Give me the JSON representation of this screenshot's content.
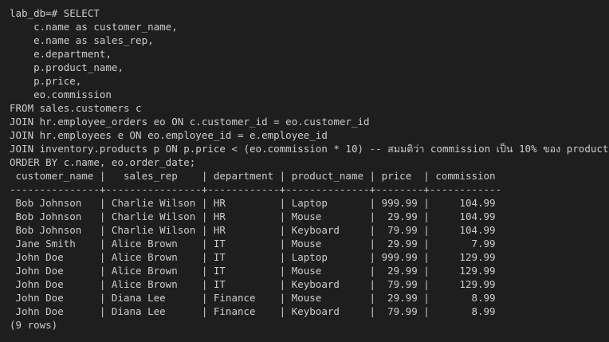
{
  "terminal": {
    "background": "#1e1e1e",
    "foreground": "#cccccc",
    "lines": [
      "lab_db=# SELECT",
      "    c.name as customer_name,",
      "    e.name as sales_rep,",
      "    e.department,",
      "    p.product_name,",
      "    p.price,",
      "    eo.commission",
      "FROM sales.customers c",
      "JOIN hr.employee_orders eo ON c.customer_id = eo.customer_id",
      "JOIN hr.employees e ON eo.employee_id = e.employee_id",
      "JOIN inventory.products p ON p.price < (eo.commission * 10) -- สมมติว่า commission เป็น 10% ของ product price",
      "ORDER BY c.name, eo.order_date;",
      " customer_name |   sales_rep    | department | product_name | price  | commission",
      "---------------+----------------+------------+--------------+--------+------------",
      " Bob Johnson   | Charlie Wilson | HR         | Laptop       | 999.99 |     104.99",
      " Bob Johnson   | Charlie Wilson | HR         | Mouse        |  29.99 |     104.99",
      " Bob Johnson   | Charlie Wilson | HR         | Keyboard     |  79.99 |     104.99",
      " Jane Smith    | Alice Brown    | IT         | Mouse        |  29.99 |       7.99",
      " John Doe      | Alice Brown    | IT         | Laptop       | 999.99 |     129.99",
      " John Doe      | Alice Brown    | IT         | Mouse        |  29.99 |     129.99",
      " John Doe      | Alice Brown    | IT         | Keyboard     |  79.99 |     129.99",
      " John Doe      | Diana Lee      | Finance    | Mouse        |  29.99 |       8.99",
      " John Doe      | Diana Lee      | Finance    | Keyboard     |  79.99 |       8.99",
      "(9 rows)"
    ]
  }
}
